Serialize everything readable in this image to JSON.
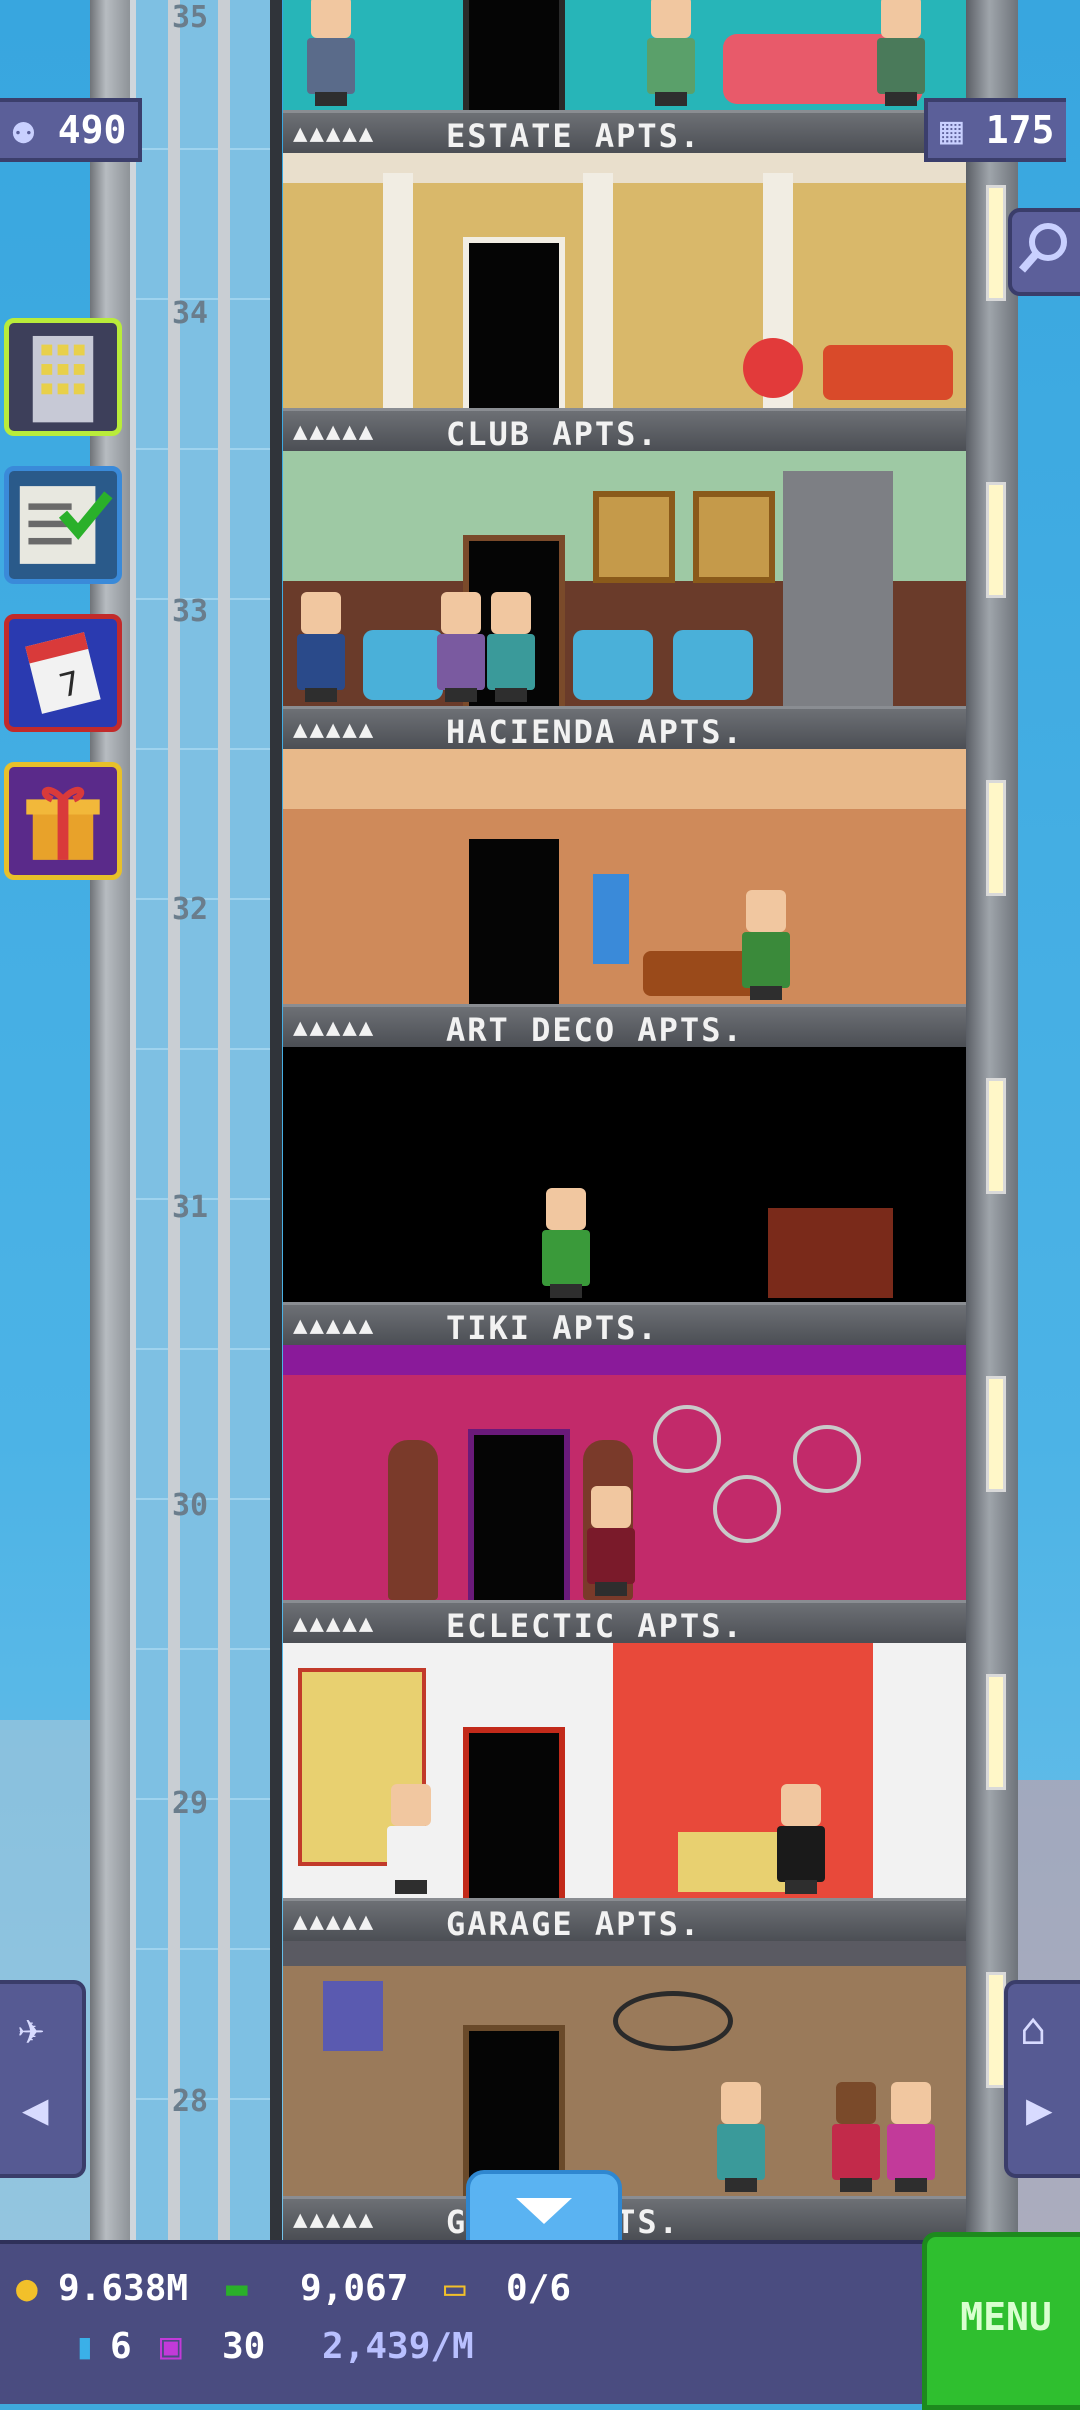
{
  "hud": {
    "population": "490",
    "floors": "175",
    "coins": "9.638M",
    "bux": "9,067",
    "tickets": "0/6",
    "tower_points": "6",
    "vip": "30",
    "rate": "2,439/M",
    "menu_label": "MENU"
  },
  "floors": [
    {
      "number": "35",
      "stars": "▲▲▲▲▲",
      "name": "ESTATE APTS."
    },
    {
      "number": "34",
      "stars": "▲▲▲▲▲",
      "name": "CLUB APTS."
    },
    {
      "number": "33",
      "stars": "▲▲▲▲▲",
      "name": "HACIENDA APTS."
    },
    {
      "number": "32",
      "stars": "▲▲▲▲▲",
      "name": "ART DECO APTS."
    },
    {
      "number": "31",
      "stars": "▲▲▲▲▲",
      "name": "TIKI APTS."
    },
    {
      "number": "30",
      "stars": "▲▲▲▲▲",
      "name": "ECLECTIC APTS."
    },
    {
      "number": "29",
      "stars": "▲▲▲▲▲",
      "name": "GARAGE APTS."
    },
    {
      "number": "28",
      "stars": "▲▲▲▲▲",
      "name": "G     EEK APTS."
    }
  ],
  "icons": {
    "population": "person-icon",
    "floors": "building-grid-icon",
    "search": "magnifier-icon",
    "build": "building-icon",
    "missions": "checklist-icon",
    "calendar": "calendar-icon",
    "gift": "gift-icon",
    "coin": "coin-icon",
    "bux": "bux-icon",
    "ticket": "ticket-icon"
  },
  "colors": {
    "hud_bg": "#4a4c80",
    "menu_green": "#2fbf2f",
    "sky": "#3fa9dc"
  }
}
